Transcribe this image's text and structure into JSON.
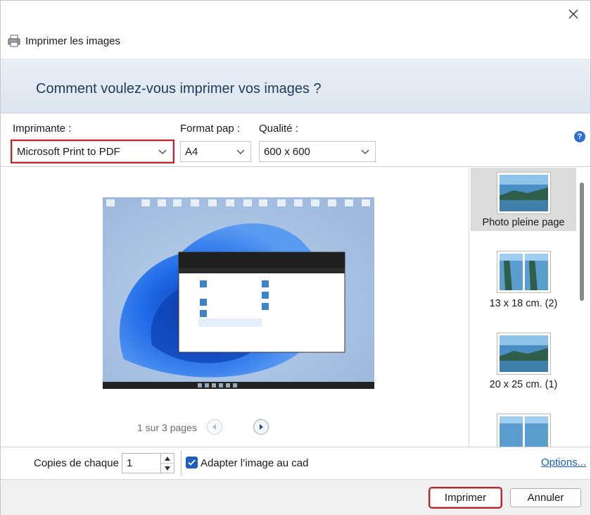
{
  "window": {
    "title": "Imprimer les images",
    "close_icon": "close-icon"
  },
  "banner": {
    "title": "Comment voulez-vous imprimer vos images ?"
  },
  "controls": {
    "printer_label": "Imprimante :",
    "printer_value": "Microsoft Print to PDF",
    "paper_label": "Format pap :",
    "paper_value": "A4",
    "quality_label": "Qualité :",
    "quality_value": "600 x 600"
  },
  "preview": {
    "pager_text": "1 sur 3 pages"
  },
  "layouts": {
    "items": [
      {
        "label": "Photo pleine page",
        "selected": true
      },
      {
        "label": "13 x 18 cm. (2)",
        "selected": false
      },
      {
        "label": "20 x 25 cm. (1)",
        "selected": false
      },
      {
        "label": "",
        "selected": false
      }
    ]
  },
  "bottom": {
    "copies_label": "Copies de chaque",
    "copies_value": "1",
    "fit_label": "Adapter l’image au cad",
    "fit_checked": true,
    "options_link": "Options..."
  },
  "footer": {
    "print_button": "Imprimer",
    "cancel_button": "Annuler"
  },
  "colors": {
    "highlight": "#c8202b",
    "accent": "#1f5fbf",
    "banner_text": "#1e3b5a"
  }
}
